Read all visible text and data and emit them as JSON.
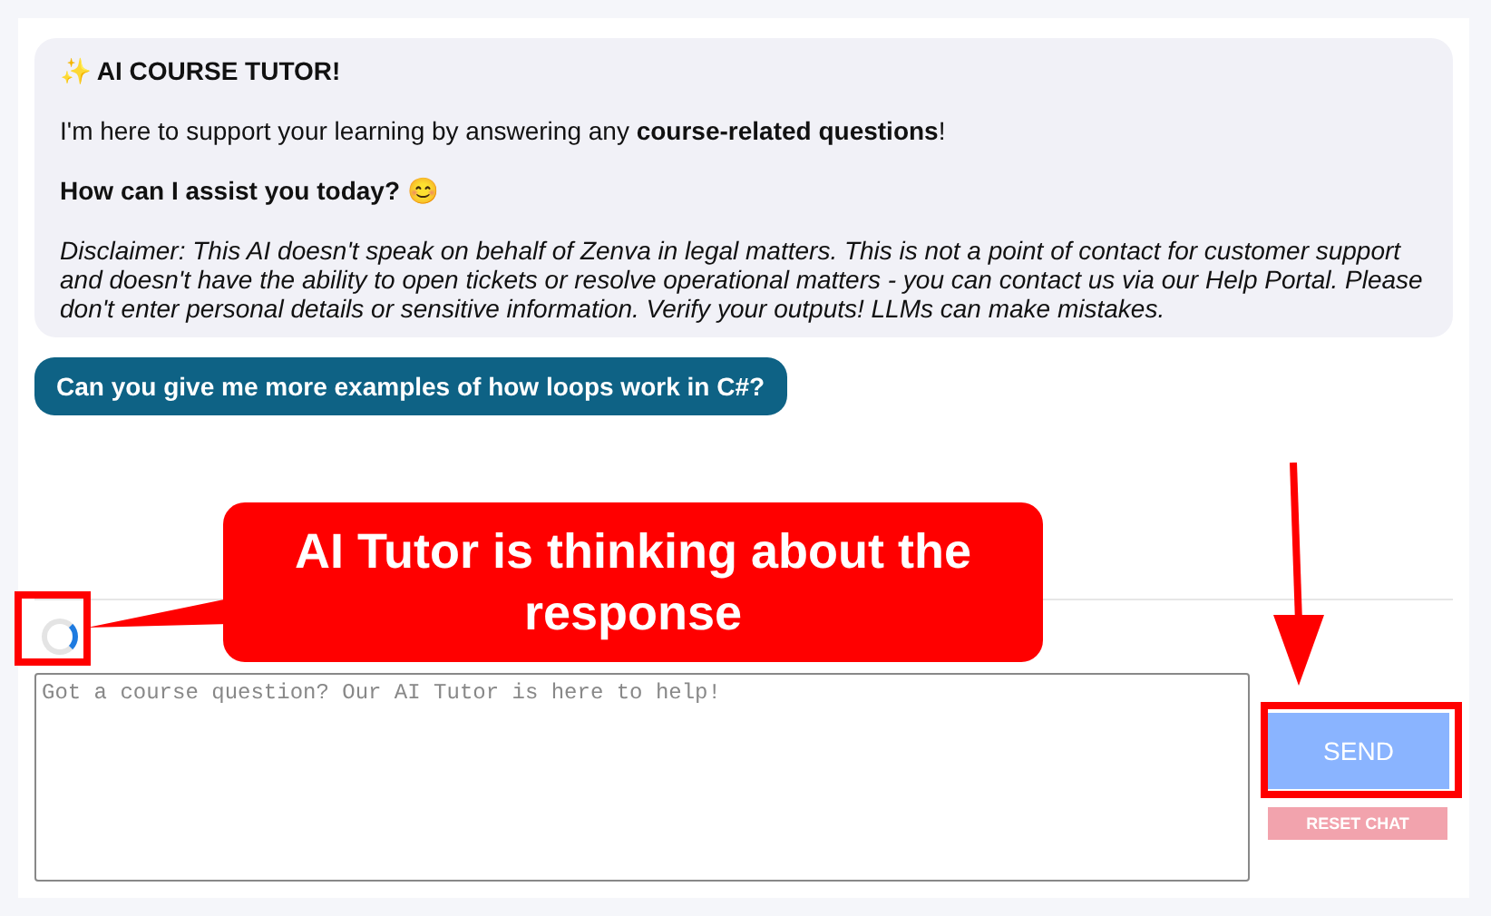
{
  "bot_message": {
    "title": "✨ AI COURSE TUTOR!",
    "intro": "I'm here to support your learning by answering any **course-related questions**!",
    "question": "How can I assist you today? 😊",
    "disclaimer": "Disclaimer: This AI doesn't speak on behalf of Zenva in legal matters. This is not a point of contact for customer support and doesn't have the ability to open tickets or resolve operational matters - you can contact us via our Help Portal. Please don't enter personal details or sensitive information. Verify your outputs! LLMs can make mistakes."
  },
  "user_message": "Can you give me more examples of how loops work in C#?",
  "loading": true,
  "input": {
    "placeholder": "Got a course question? Our AI Tutor is here to help!"
  },
  "buttons": [
    {
      "kind": "send",
      "label": "SEND",
      "disabled": true
    },
    {
      "kind": "reset",
      "label": "RESET CHAT",
      "disabled": true
    }
  ],
  "annotation": {
    "callout": "AI Tutor is thinking about the response"
  }
}
